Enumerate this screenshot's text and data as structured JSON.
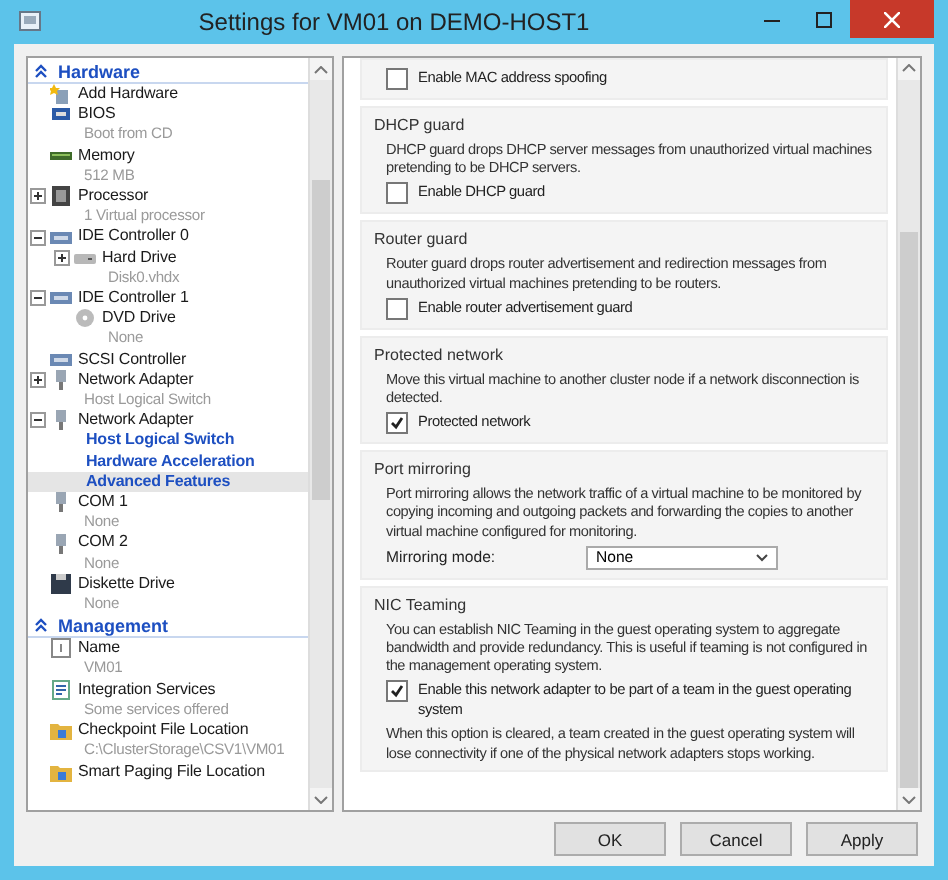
{
  "window": {
    "title": "Settings for VM01 on DEMO-HOST1"
  },
  "tree": {
    "sections": [
      {
        "title": "Hardware",
        "expanded": true,
        "items": [
          {
            "kind": "add",
            "label": "Add Hardware",
            "selected": false
          },
          {
            "kind": "bios",
            "label": "BIOS",
            "detail": "Boot from CD",
            "selected": false
          },
          {
            "kind": "memory",
            "label": "Memory",
            "detail": "512 MB",
            "selected": false
          },
          {
            "kind": "processor",
            "label": "Processor",
            "detail": "1 Virtual processor",
            "expanded": false,
            "selected": false
          },
          {
            "kind": "controller",
            "label": "IDE Controller 0",
            "expanded": true,
            "selected": false,
            "children": [
              {
                "kind": "disk",
                "label": "Hard Drive",
                "detail": "Disk0.vhdx",
                "expanded": false,
                "selected": false
              }
            ]
          },
          {
            "kind": "controller",
            "label": "IDE Controller 1",
            "expanded": true,
            "selected": false,
            "children": [
              {
                "kind": "dvd",
                "label": "DVD Drive",
                "detail": "None",
                "selected": false
              }
            ]
          },
          {
            "kind": "scsi",
            "label": "SCSI Controller",
            "selected": false
          },
          {
            "kind": "nic",
            "label": "Network Adapter",
            "detail": "Host Logical Switch",
            "expanded": false,
            "selected": false
          },
          {
            "kind": "nic",
            "label": "Network Adapter",
            "expanded": true,
            "selected": false,
            "children": [
              {
                "kind": "link",
                "label": "Host Logical Switch",
                "selected": false
              },
              {
                "kind": "link",
                "label": "Hardware Acceleration",
                "selected": false
              },
              {
                "kind": "link",
                "label": "Advanced Features",
                "selected": true
              }
            ]
          },
          {
            "kind": "com",
            "label": "COM 1",
            "detail": "None",
            "selected": false
          },
          {
            "kind": "com",
            "label": "COM 2",
            "detail": "None",
            "selected": false
          },
          {
            "kind": "floppy",
            "label": "Diskette Drive",
            "detail": "None",
            "selected": false
          }
        ]
      },
      {
        "title": "Management",
        "expanded": true,
        "items": [
          {
            "kind": "name",
            "label": "Name",
            "detail": "VM01",
            "selected": false
          },
          {
            "kind": "integration",
            "label": "Integration Services",
            "detail": "Some services offered",
            "selected": false
          },
          {
            "kind": "folder",
            "label": "Checkpoint File Location",
            "detail": "C:\\ClusterStorage\\CSV1\\VM01",
            "selected": false
          },
          {
            "kind": "folder",
            "label": "Smart Paging File Location",
            "selected": false
          }
        ]
      }
    ]
  },
  "groups": [
    {
      "controls": [
        {
          "kind": "checkbox",
          "label": "Enable MAC address spoofing",
          "checked": false
        }
      ]
    },
    {
      "title": "DHCP guard",
      "text": "DHCP guard drops DHCP server messages from unauthorized virtual machines pretending to be DHCP servers.",
      "controls": [
        {
          "kind": "checkbox",
          "label": "Enable DHCP guard",
          "checked": false
        }
      ]
    },
    {
      "title": "Router guard",
      "text": "Router guard drops router advertisement and redirection messages from unauthorized virtual machines pretending to be routers.",
      "controls": [
        {
          "kind": "checkbox",
          "label": "Enable router advertisement guard",
          "checked": false
        }
      ]
    },
    {
      "title": "Protected network",
      "text": "Move this virtual machine to another cluster node if a network disconnection is detected.",
      "controls": [
        {
          "kind": "checkbox",
          "label": "Protected network",
          "checked": true
        }
      ]
    },
    {
      "title": "Port mirroring",
      "text": "Port mirroring allows the network traffic of a virtual machine to be monitored by copying incoming and outgoing packets and forwarding the copies to another virtual machine configured for monitoring.",
      "controls": [
        {
          "kind": "select",
          "label": "Mirroring mode:",
          "value": "None"
        }
      ]
    },
    {
      "title": "NIC Teaming",
      "text": "You can establish NIC Teaming in the guest operating system to aggregate bandwidth and provide redundancy. This is useful if teaming is not configured in the management operating system.",
      "controls": [
        {
          "kind": "checkbox",
          "label": "Enable this network adapter to be part of a team in the guest operating system",
          "checked": true
        }
      ],
      "note": "When this option is cleared, a team created in the guest operating system will lose connectivity if one of the physical network adapters stops working."
    }
  ],
  "buttons": [
    {
      "label": "OK"
    },
    {
      "label": "Cancel"
    },
    {
      "label": "Apply"
    }
  ]
}
